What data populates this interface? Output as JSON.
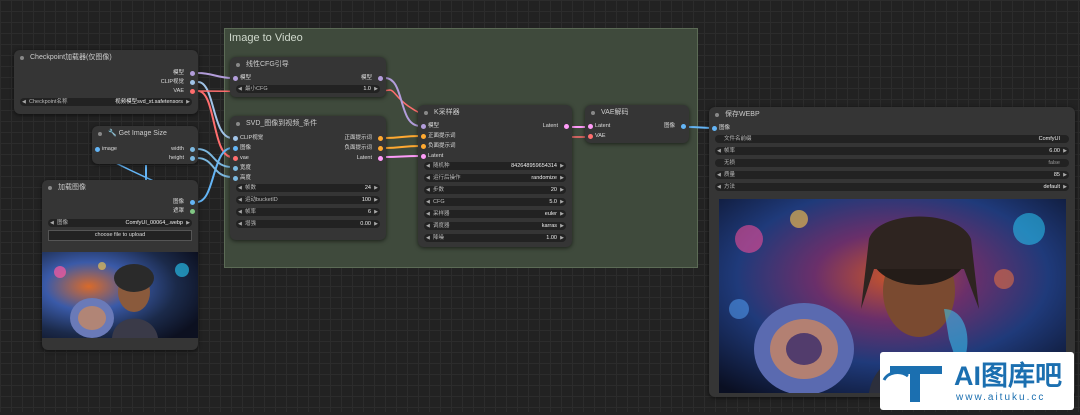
{
  "group": {
    "title": "Image to Video"
  },
  "checkpoint": {
    "title": "Checkpoint加载器(仅图像)",
    "outputs": [
      "模型",
      "CLIP视觉",
      "VAE"
    ],
    "ckpt_label": "Checkpoint名称",
    "ckpt_value": "视频模型svd_xt.safetensors"
  },
  "get_size": {
    "title": "Get Image Size",
    "input": "image",
    "outputs": [
      "width",
      "height"
    ]
  },
  "load_image": {
    "title": "加载图像",
    "outputs": [
      "图像",
      "遮罩"
    ],
    "image_label": "图像",
    "image_value": "ComfyUI_00064_.webp",
    "upload_label": "choose file to upload"
  },
  "cfg_guide": {
    "title": "线性CFG引导",
    "input": "模型",
    "output": "模型",
    "min_cfg_label": "最小CFG",
    "min_cfg_value": "1.0"
  },
  "svd": {
    "title": "SVD_图像到视频_条件",
    "inputs": [
      "CLIP视觉",
      "图像",
      "vae",
      "宽度",
      "高度"
    ],
    "outputs": [
      "正面提示词",
      "负面提示词",
      "Latent"
    ],
    "widgets": [
      {
        "label": "帧数",
        "value": "24"
      },
      {
        "label": "运动bucketID",
        "value": "100"
      },
      {
        "label": "帧率",
        "value": "6"
      },
      {
        "label": "增强",
        "value": "0.00"
      }
    ]
  },
  "ksampler": {
    "title": "K采样器",
    "inputs": [
      "模型",
      "正面提示词",
      "负面提示词",
      "Latent"
    ],
    "output": "Latent",
    "widgets": [
      {
        "label": "随机种",
        "value": "842648959654314"
      },
      {
        "label": "运行后操作",
        "value": "randomize"
      },
      {
        "label": "步数",
        "value": "20"
      },
      {
        "label": "CFG",
        "value": "5.0"
      },
      {
        "label": "采样器",
        "value": "euler"
      },
      {
        "label": "调度器",
        "value": "karras"
      },
      {
        "label": "降噪",
        "value": "1.00"
      }
    ]
  },
  "vae_decode": {
    "title": "VAE解码",
    "inputs": [
      "Latent",
      "VAE"
    ],
    "output": "图像"
  },
  "save_webp": {
    "title": "保存WEBP",
    "input": "图像",
    "widgets": [
      {
        "label": "文件名前缀",
        "value": "ComfyUI"
      },
      {
        "label": "帧率",
        "value": "6.00"
      },
      {
        "label": "无损",
        "value": "false"
      },
      {
        "label": "质量",
        "value": "85"
      },
      {
        "label": "方法",
        "value": "default"
      }
    ]
  },
  "watermark": {
    "brand": "AI图库吧",
    "url": "www.aituku.cc"
  },
  "colors": {
    "model": "#b39ddb",
    "clip_vision": "#a1c4e8",
    "vae": "#ff6e6e",
    "image": "#64b5f6",
    "latent": "#ff9cf9",
    "conditioning": "#ffa931",
    "int": "#7cb8e0",
    "mask": "#81c784"
  }
}
